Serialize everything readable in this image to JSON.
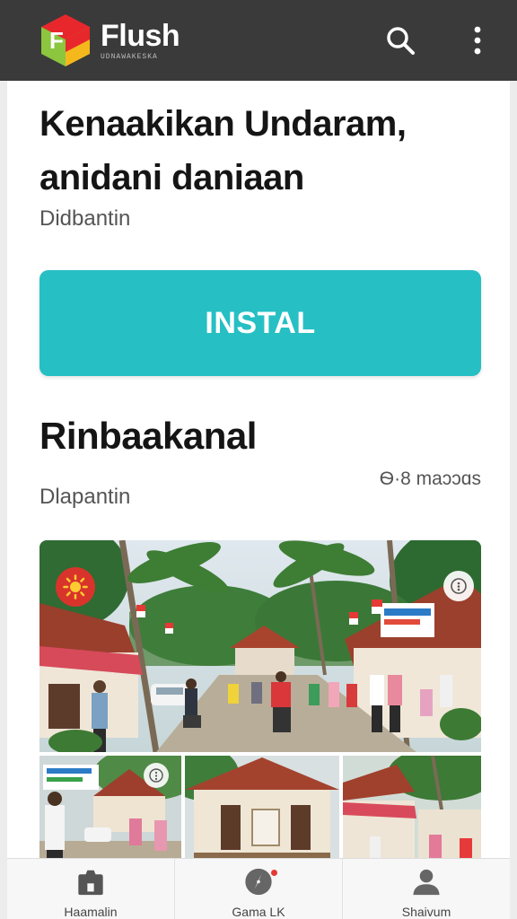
{
  "app": {
    "name": "Flush",
    "tagline": "UDNAWAKESKA"
  },
  "header": {
    "search_icon": "search-icon",
    "menu_icon": "more-vertical-icon"
  },
  "main": {
    "title": "Kenaakikan Undaram, anidani daniaan",
    "subtitle": "Didbantin",
    "install_label": "INSTAL",
    "section_title": "Rinbaakanal",
    "section_meta": "Ѳ·8 maɔɔɑs",
    "section_subtitle": "Dlapantin"
  },
  "gallery": {
    "main_badge_icon": "sun-flag-icon",
    "more_icon": "more-icon"
  },
  "bottom_nav": {
    "items": [
      {
        "label": "Haamalin",
        "icon": "store-icon"
      },
      {
        "label": "Gama LK",
        "icon": "compass-icon"
      },
      {
        "label": "Shaivum",
        "icon": "person-icon"
      }
    ]
  },
  "colors": {
    "appbar": "#3a3a3a",
    "accent": "#26bfc4",
    "badge_red": "#d9342b"
  }
}
